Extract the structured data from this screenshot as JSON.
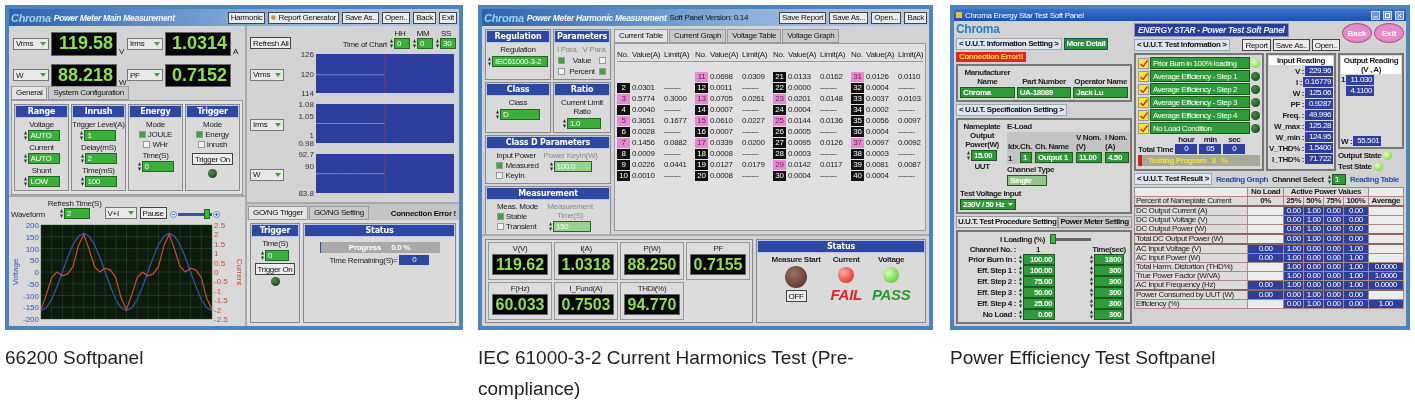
{
  "panels": [
    {
      "kind": "main",
      "caption": "66200 Softpanel",
      "logo": "Chroma",
      "title": "Power Meter Main Measurement",
      "buttons": [
        {
          "label": "Harmonic",
          "kind": "plain"
        },
        {
          "label": "Report Generator",
          "kind": "report"
        },
        {
          "label": "Save As..",
          "kind": "plain"
        },
        {
          "label": "Open..",
          "kind": "plain"
        },
        {
          "label": "Back",
          "kind": "plain"
        },
        {
          "label": "Exit",
          "kind": "plain"
        }
      ],
      "readings": [
        {
          "selector": "Vrms",
          "value": "119.58",
          "unit": "V"
        },
        {
          "selector": "Irms",
          "value": "1.0314",
          "unit": "A"
        },
        {
          "selector": "W",
          "value": "88.218",
          "unit": "W"
        },
        {
          "selector": "PF",
          "value": "0.7152"
        }
      ],
      "tabs": [
        {
          "label": "General",
          "selected": true
        },
        {
          "label": "System Configuration",
          "selected": false
        }
      ],
      "groups": [
        {
          "title": "Range",
          "items": [
            {
              "kind": "field",
              "label": "Voltage",
              "value": "AUTO"
            },
            {
              "kind": "field",
              "label": "Current",
              "value": "AUTO"
            },
            {
              "kind": "field",
              "label": "Shunt",
              "value": "LOW"
            }
          ]
        },
        {
          "title": "Inrush",
          "items": [
            {
              "kind": "field",
              "label": "Trigger Level(A)",
              "value": "1"
            },
            {
              "kind": "field",
              "label": "Delay(mS)",
              "value": "2"
            },
            {
              "kind": "field",
              "label": "Time(mS)",
              "value": "100"
            }
          ]
        },
        {
          "title": "Energy",
          "items": [
            {
              "kind": "radio",
              "label": "Mode",
              "options": [
                {
                  "label": "JOULE",
                  "selected": true
                },
                {
                  "label": "WHr",
                  "selected": false
                }
              ]
            },
            {
              "kind": "field",
              "label": "Time(S)",
              "value": "0"
            }
          ]
        },
        {
          "title": "Trigger",
          "items": [
            {
              "kind": "radio",
              "label": "Mode",
              "options": [
                {
                  "label": "Energy",
                  "selected": true
                },
                {
                  "label": "Inrush",
                  "selected": false
                }
              ]
            },
            {
              "kind": "button",
              "label": "Trigger On"
            },
            {
              "kind": "led",
              "on": false
            }
          ]
        }
      ],
      "waveform": {
        "refresh_label": "Refresh Time(S)",
        "refresh_value": "2",
        "label": "Waveform",
        "selector": "V+I",
        "pause": "Pause",
        "level": 0.85,
        "chart_data": {
          "type": "line",
          "grid": true,
          "ylim": [
            -200,
            200
          ],
          "yticks": [
            200,
            150,
            100,
            50,
            0,
            -50,
            -100,
            -150,
            -200
          ],
          "y2lim": [
            -2.5,
            2.5
          ],
          "y2ticks": [
            2.5,
            2,
            1.5,
            1,
            0.5,
            0,
            -0.5,
            -1,
            -1.5,
            -2,
            -2.5
          ],
          "series": [
            {
              "name": "Voltage",
              "color": "#3553b8",
              "values": [
                -165,
                -152,
                -117,
                -63,
                0,
                63,
                117,
                152,
                165,
                152,
                117,
                63,
                0,
                -63,
                -117,
                -152,
                -165,
                -152,
                -117,
                -63,
                0,
                63,
                117,
                152,
                165,
                152,
                117,
                63,
                0,
                -63,
                -117,
                -152,
                -165
              ]
            },
            {
              "name": "Current",
              "color": "#d0493a",
              "axis": "y2",
              "values": [
                -2,
                -1.2,
                -0.3,
                0,
                -0.2,
                -0.1,
                0.3,
                1.4,
                2,
                1.2,
                0.3,
                0,
                0.2,
                0.1,
                -0.3,
                -1.4,
                -2,
                -1.2,
                -0.3,
                0,
                -0.2,
                -0.1,
                0.3,
                1.4,
                2,
                1.2,
                0.3,
                0,
                0.2,
                0.1,
                -0.3,
                -1.4,
                -2
              ]
            }
          ]
        }
      },
      "refresh_all": "Refresh All",
      "time_of_chart": {
        "label": "Time of Chart",
        "fields": [
          {
            "label": "HH",
            "value": "0"
          },
          {
            "label": "MM",
            "value": "0"
          },
          {
            "label": "SS",
            "value": "30"
          }
        ]
      },
      "trends": [
        {
          "selector": "Vrms",
          "chart_data": {
            "type": "line",
            "ylim": [
              114,
              126
            ],
            "yticks": [
              126,
              120,
              114
            ],
            "series": [
              {
                "color": "#8d96d8",
                "values": [
                  119.6,
                  119.6,
                  119.6,
                  119.6,
                  119.6,
                  null,
                  null,
                  null,
                  null,
                  null
                ]
              }
            ]
          }
        },
        {
          "selector": "Irms",
          "chart_data": {
            "type": "line",
            "ylim": [
              0.98,
              1.08
            ],
            "yticks": [
              1.08,
              1.05,
              1,
              0.98
            ],
            "series": [
              {
                "color": "#8d96d8",
                "values": [
                  1.03,
                  1.03,
                  1.03,
                  1.03,
                  1.03,
                  null,
                  null,
                  null,
                  null,
                  null
                ]
              }
            ]
          }
        },
        {
          "selector": "W",
          "chart_data": {
            "type": "line",
            "ylim": [
              83.8,
              92.7
            ],
            "yticks": [
              92.7,
              90,
              83.8
            ],
            "series": [
              {
                "color": "#8d96d8",
                "values": [
                  88.2,
                  88.2,
                  88.2,
                  88.2,
                  88.2,
                  null,
                  null,
                  null,
                  null,
                  null
                ]
              }
            ]
          }
        }
      ],
      "bottom_tabs": [
        {
          "label": "GO/NG Trigger",
          "selected": true
        },
        {
          "label": "GO/NG Setting",
          "selected": false
        }
      ],
      "connection_status": "Connection Error !",
      "trigger": {
        "title": "Trigger",
        "time_label": "Time(S)",
        "time_value": "0",
        "button": "Trigger On",
        "on": false
      },
      "status": {
        "title": "Status",
        "progress_label": "Progress",
        "progress_value": "0.0 %",
        "level": 0.01,
        "remaining_label": "Time Remaining(S)=",
        "remaining_value": "0"
      }
    },
    {
      "kind": "harmonic",
      "caption": "IEC 61000-3-2 Current Harmonics Test (Pre-compliance)",
      "logo": "Chroma",
      "title": "Power Meter Harmonic Measurement",
      "version": "Soft Panel Version: 0.14",
      "buttons": [
        {
          "label": "Save Report"
        },
        {
          "label": "Save As..."
        },
        {
          "label": "Open..."
        },
        {
          "label": "Back"
        }
      ],
      "regulation": {
        "title": "Regulation",
        "label": "Regulation",
        "value": "IEC61000-3-2"
      },
      "parameters": {
        "title": "Parameters",
        "columns": [
          "I Para.",
          "V Para."
        ],
        "rows": [
          {
            "label": "Value",
            "i": true,
            "v": false
          },
          {
            "label": "Percent",
            "i": false,
            "v": true
          }
        ]
      },
      "class": {
        "title": "Class",
        "label": "Class",
        "value": "D"
      },
      "ratio": {
        "title": "Ratio",
        "label": "Current Limit Ratio",
        "value": "1.0"
      },
      "class_d": {
        "title": "Class D Parameters",
        "label": "Input Power",
        "options": [
          {
            "label": "Measured",
            "selected": true
          },
          {
            "label": "KeyIn",
            "selected": false
          }
        ],
        "field_label": "Power KeyIn(W)",
        "field_value": "100.0",
        "disabled": true
      },
      "measurement": {
        "title": "Measurement",
        "label": "Meas. Mode",
        "options": [
          {
            "label": "Stable",
            "selected": true
          },
          {
            "label": "Transient",
            "selected": false
          }
        ],
        "field_label": "Measurement Time(S)",
        "field_value": "150",
        "disabled": true
      },
      "tabs": [
        {
          "label": "Current Table",
          "selected": true
        },
        {
          "label": "Current Graph",
          "selected": false
        },
        {
          "label": "Voltage Table",
          "selected": false
        },
        {
          "label": "Voltage Graph",
          "selected": false
        }
      ],
      "table": {
        "groups": [
          {
            "columns": [
              "No.",
              "Value(A)",
              "Limit(A)"
            ],
            "rows": [
              {
                "no": "2",
                "value": "0.0301",
                "limit": "-------",
                "over": false
              },
              {
                "no": "3",
                "value": "0.5774",
                "limit": "0.3000",
                "over": true
              },
              {
                "no": "4",
                "value": "0.0040",
                "limit": "-------",
                "over": false
              },
              {
                "no": "5",
                "value": "0.3651",
                "limit": "0.1677",
                "over": true
              },
              {
                "no": "6",
                "value": "0.0028",
                "limit": "-------",
                "over": false
              },
              {
                "no": "7",
                "value": "0.1456",
                "limit": "0.0882",
                "over": true
              },
              {
                "no": "8",
                "value": "0.0009",
                "limit": "-------",
                "over": false
              },
              {
                "no": "9",
                "value": "0.0226",
                "limit": "0.0441",
                "over": false
              },
              {
                "no": "10",
                "value": "0.0010",
                "limit": "-------",
                "over": false
              }
            ]
          },
          {
            "columns": [
              "No.",
              "Value(A)",
              "Limit(A)"
            ],
            "rows": [
              {
                "no": "11",
                "value": "0.0698",
                "limit": "0.0309",
                "over": true
              },
              {
                "no": "12",
                "value": "0.0011",
                "limit": "-------",
                "over": false
              },
              {
                "no": "13",
                "value": "0.0705",
                "limit": "0.0261",
                "over": true
              },
              {
                "no": "14",
                "value": "0.0007",
                "limit": "-------",
                "over": false
              },
              {
                "no": "15",
                "value": "0.0610",
                "limit": "0.0227",
                "over": true
              },
              {
                "no": "16",
                "value": "0.0007",
                "limit": "-------",
                "over": false
              },
              {
                "no": "17",
                "value": "0.0339",
                "limit": "0.0200",
                "over": true
              },
              {
                "no": "18",
                "value": "0.0008",
                "limit": "-------",
                "over": false
              },
              {
                "no": "19",
                "value": "0.0127",
                "limit": "0.0179",
                "over": false
              },
              {
                "no": "20",
                "value": "0.0008",
                "limit": "-------",
                "over": false
              }
            ]
          },
          {
            "columns": [
              "No.",
              "Value(A)",
              "Limit(A)"
            ],
            "rows": [
              {
                "no": "21",
                "value": "0.0133",
                "limit": "0.0162",
                "over": false
              },
              {
                "no": "22",
                "value": "0.0000",
                "limit": "-------",
                "over": false
              },
              {
                "no": "23",
                "value": "0.0201",
                "limit": "0.0148",
                "over": true
              },
              {
                "no": "24",
                "value": "0.0004",
                "limit": "-------",
                "over": false
              },
              {
                "no": "25",
                "value": "0.0144",
                "limit": "0.0136",
                "over": true
              },
              {
                "no": "26",
                "value": "0.0005",
                "limit": "-------",
                "over": false
              },
              {
                "no": "27",
                "value": "0.0095",
                "limit": "0.0126",
                "over": false
              },
              {
                "no": "28",
                "value": "0.0003",
                "limit": "-------",
                "over": false
              },
              {
                "no": "29",
                "value": "0.0142",
                "limit": "0.0117",
                "over": true
              },
              {
                "no": "30",
                "value": "0.0004",
                "limit": "-------",
                "over": false
              }
            ]
          },
          {
            "columns": [
              "No.",
              "Value(A)",
              "Limit(A)"
            ],
            "rows": [
              {
                "no": "31",
                "value": "0.0126",
                "limit": "0.0110",
                "over": true
              },
              {
                "no": "32",
                "value": "0.0004",
                "limit": "-------",
                "over": false
              },
              {
                "no": "33",
                "value": "0.0037",
                "limit": "0.0103",
                "over": false
              },
              {
                "no": "34",
                "value": "0.0002",
                "limit": "-------",
                "over": false
              },
              {
                "no": "35",
                "value": "0.0056",
                "limit": "0.0097",
                "over": false
              },
              {
                "no": "36",
                "value": "0.0004",
                "limit": "-------",
                "over": false
              },
              {
                "no": "37",
                "value": "0.0097",
                "limit": "0.0092",
                "over": true
              },
              {
                "no": "38",
                "value": "0.0003",
                "limit": "-------",
                "over": false
              },
              {
                "no": "39",
                "value": "0.0081",
                "limit": "0.0087",
                "over": false
              },
              {
                "no": "40",
                "value": "0.0004",
                "limit": "-------",
                "over": false
              }
            ]
          }
        ]
      },
      "meters": [
        {
          "label": "V(V)",
          "value": "119.62"
        },
        {
          "label": "I(A)",
          "value": "1.0318"
        },
        {
          "label": "P(W)",
          "value": "88.250"
        },
        {
          "label": "PF",
          "value": "0.7155"
        },
        {
          "label": "F(Hz)",
          "value": "60.033"
        },
        {
          "label": "I_Fund(A)",
          "value": "0.7503"
        },
        {
          "label": "THDi(%)",
          "value": "94.770"
        }
      ],
      "status": {
        "title": "Status",
        "start_label": "Measure Start",
        "start_button": "OFF",
        "checks": [
          {
            "label": "Current",
            "result": "FAIL",
            "pass": false
          },
          {
            "label": "Voltage",
            "result": "PASS",
            "pass": true
          }
        ]
      }
    },
    {
      "kind": "efficiency",
      "caption": "Power Efficiency Test Softpanel",
      "window_title": "Chroma Energy Star Test Soft Panel",
      "logo": "Chroma",
      "banner": "ENERGY STAR - Power Test Soft Panel",
      "info_tab": "< U.U.T. Information Setting >",
      "more_detail": "More Detail",
      "connection_status": "Connection Error!!",
      "buttons": [
        {
          "label": "Report"
        },
        {
          "label": "Save As.."
        },
        {
          "label": "Open.."
        }
      ],
      "round_buttons": [
        {
          "label": "Back"
        },
        {
          "label": "Exit"
        }
      ],
      "uut_info": [
        {
          "label": "Manufacturer Name",
          "value": "Chroma"
        },
        {
          "label": "Part Number",
          "value": "UA-18089"
        },
        {
          "label": "Operator Name",
          "value": "Jack Lu"
        }
      ],
      "spec_tab": "< U.U.T. Specification Setting >",
      "spec": {
        "nameplate_label": "Nameplate Output Power(W)",
        "nameplate_value": "15.00",
        "nameplate_unit": "UUT",
        "channel_type_label": "Channel Type",
        "channel_type": "Single",
        "eload_label": "E-Load",
        "eload_columns": [
          "Idx.",
          "Ch.",
          "Ch. Name",
          "V Nom.(V)",
          "I Nom.(A)"
        ],
        "eload_row": [
          "1",
          "1",
          "Output 1",
          "11.00",
          "4.50"
        ],
        "test_voltage_label": "Test Voltage Input",
        "test_voltage": "230V / 50 Hz"
      },
      "procedure_tabs": [
        {
          "label": "U.U.T. Test Procedure Setting",
          "selected": true
        },
        {
          "label": "Power Meter Setting",
          "selected": false
        }
      ],
      "loading": {
        "label": "I Loading (%)",
        "level": 0.05
      },
      "channel_label": "Channel No. :",
      "channel_value": "1",
      "time_label": "Time(sec)",
      "steps": [
        {
          "label": "Prior Burn in :",
          "loading": "100.00",
          "time": "1800"
        },
        {
          "label": "Eff. Step 1 :",
          "loading": "100.00",
          "time": "300"
        },
        {
          "label": "Eff. Step 2 :",
          "loading": "75.00",
          "time": "300"
        },
        {
          "label": "Eff. Step 3 :",
          "loading": "50.00",
          "time": "300"
        },
        {
          "label": "Eff. Step 4 :",
          "loading": "25.00",
          "time": "300"
        },
        {
          "label": "No Load :",
          "loading": "0.00",
          "time": "300"
        }
      ],
      "test_info_tab": "< U.U.T. Test Information >",
      "test_steps": [
        {
          "label": "Prior Burn in 100% loading",
          "checked": true,
          "on": true
        },
        {
          "label": "Average Efficiency - Step 1",
          "checked": true,
          "on": false
        },
        {
          "label": "Average Efficiency - Step 2",
          "checked": true,
          "on": false
        },
        {
          "label": "Average Efficiency - Step 3",
          "checked": true,
          "on": false
        },
        {
          "label": "Average Efficiency - Step 4",
          "checked": true,
          "on": false
        },
        {
          "label": "No Load Condition",
          "checked": true,
          "on": false
        }
      ],
      "total_time": {
        "label": "Total Time",
        "units": [
          "hour",
          "min",
          "sec"
        ],
        "values": [
          "0",
          "05",
          "0"
        ]
      },
      "progress": {
        "label": "Testing Program",
        "value": "3",
        "unit": "%",
        "level": 0.03
      },
      "input_reading": {
        "title": "Input Reading",
        "rows": [
          {
            "label": "V :",
            "value": "229.96"
          },
          {
            "label": "I :",
            "value": "0.16779"
          },
          {
            "label": "W :",
            "value": "125.06"
          },
          {
            "label": "PF :",
            "value": "0.9287"
          },
          {
            "label": "Freq. :",
            "value": "49.996"
          },
          {
            "label": "W_max :",
            "value": "125.28"
          },
          {
            "label": "W_min :",
            "value": "124.95"
          },
          {
            "label": "V_THD% :",
            "value": "1.5400"
          },
          {
            "label": "I_THD% :",
            "value": "71.722"
          }
        ]
      },
      "output_reading": {
        "title": "Output Reading (V , A)",
        "rows": [
          {
            "idx": "1",
            "v": "11.030",
            "a": "4.1100"
          }
        ],
        "w_label": "W :",
        "w_value": "55.501"
      },
      "states": [
        {
          "label": "Output State",
          "on": true
        },
        {
          "label": "Test State",
          "on": true
        }
      ],
      "result_tab": "< U.U.T. Test Result >",
      "reading_graph": "Reading Graph",
      "channel_select_label": "Channel Select",
      "channel_select": "1",
      "reading_table": "Reading Table",
      "result_table": {
        "group_heads": [
          "No Load",
          "Active Power Values"
        ],
        "percent_label": "Percent of Nameplate Current",
        "percents": [
          "0%",
          "25%",
          "50%",
          "75%",
          "100%"
        ],
        "average": "Average",
        "sections": [
          [
            {
              "label": "DC Output Current (A)",
              "cells": [
                null,
                "0.00",
                "1.00",
                "0.00",
                "0.00",
                null
              ]
            },
            {
              "label": "DC Output Voltage (V)",
              "cells": [
                null,
                "0.00",
                "1.00",
                "0.00",
                "0.00",
                null
              ]
            },
            {
              "label": "DC Output Power (W)",
              "cells": [
                null,
                "0.00",
                "1.00",
                "0.00",
                "0.00",
                null
              ]
            }
          ],
          [
            {
              "label": "Total DC Output Power (W)",
              "cells": [
                null,
                "0.00",
                "1.00",
                "0.00",
                "0.00",
                null
              ]
            }
          ],
          [
            {
              "label": "AC Input Voltage (V)",
              "cells": [
                "0.00",
                "1.00",
                "0.00",
                "0.00",
                "1.00",
                null
              ]
            },
            {
              "label": "AC Input Power (W)",
              "cells": [
                "0.00",
                "1.00",
                "0.00",
                "0.00",
                "1.00",
                null
              ]
            },
            {
              "label": "Total Harm. Distortion (THD%)",
              "cells": [
                null,
                "1.00",
                "0.00",
                "0.00",
                "1.00",
                "0.0000"
              ]
            },
            {
              "label": "True Power Factor (W/VA)",
              "cells": [
                null,
                "1.00",
                "0.00",
                "0.00",
                "1.00",
                "1.0000"
              ]
            },
            {
              "label": "AC Input Frequency (Hz)",
              "cells": [
                "0.00",
                "1.00",
                "0.00",
                "0.00",
                "1.00",
                "0.0000"
              ]
            }
          ],
          [
            {
              "label": "Power Consumed by UUT (W)",
              "cells": [
                "0.00",
                "0.00",
                "1.00",
                "0.00",
                "0.00",
                null
              ]
            },
            {
              "label": "Efficiency (%)",
              "cells": [
                null,
                "0.00",
                "1.00",
                "0.00",
                "0.00",
                "1.00"
              ]
            }
          ]
        ]
      }
    }
  ]
}
